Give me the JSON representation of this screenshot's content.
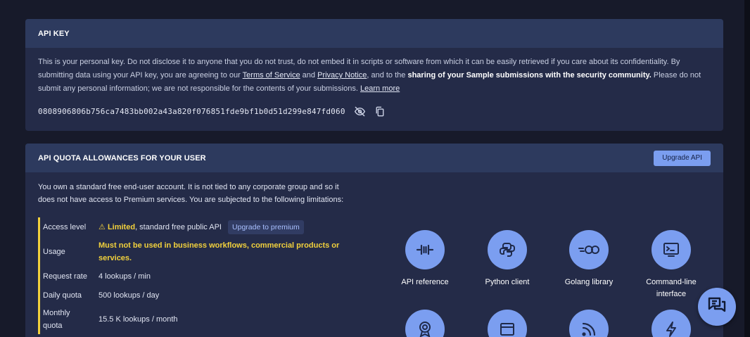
{
  "api_key": {
    "title": "API KEY",
    "para_1": "This is your personal key. Do not disclose it to anyone that you do not trust, do not embed it in scripts or software from which it can be easily retrieved if you care about its confidentiality. By submitting data using your API key, you are agreeing to our ",
    "terms_link": "Terms of Service",
    "and_text": " and ",
    "privacy_link": "Privacy Notice",
    "para_2": ", and to the ",
    "sharing_bold": "sharing of your Sample submissions with the security community.",
    "para_3": " Please do not submit any personal information; we are not responsible for the contents of your submissions. ",
    "learn_more": "Learn more",
    "key_value": "0808906806b756ca7483bb002a43a820f076851fde9bf1b0d51d299e847fd060",
    "icons": {
      "hide": "eye-slash-icon",
      "copy": "copy-icon"
    }
  },
  "quota": {
    "title": "API QUOTA ALLOWANCES FOR YOUR USER",
    "upgrade_button": "Upgrade API",
    "intro": "You own a standard free end-user account. It is not tied to any corporate group and so it does not have access to Premium services. You are subjected to the following limitations:",
    "rows": [
      {
        "key": "Access level",
        "warn_icon": "⚠",
        "value_bold": "Limited",
        "value_rest": ", standard free public API",
        "pill": "Upgrade to premium"
      },
      {
        "key": "Usage",
        "value": "Must not be used in business workflows, commercial products or services."
      },
      {
        "key": "Request rate",
        "value": "4 lookups / min"
      },
      {
        "key": "Daily quota",
        "value": "500 lookups / day"
      },
      {
        "key": "Monthly quota",
        "value": "15.5 K lookups / month"
      }
    ]
  },
  "resources": [
    {
      "label": "API reference",
      "icon": "api-icon"
    },
    {
      "label": "Python client",
      "icon": "python-icon"
    },
    {
      "label": "Golang library",
      "icon": "gopher-icon"
    },
    {
      "label": "Command-line interface",
      "icon": "terminal-icon"
    },
    {
      "label": "",
      "icon": "badge-icon"
    },
    {
      "label": "",
      "icon": "window-icon"
    },
    {
      "label": "",
      "icon": "rss-icon"
    },
    {
      "label": "",
      "icon": "bolt-icon"
    }
  ],
  "colors": {
    "accent": "#7b9ef0",
    "warning": "#f2d13c",
    "card": "#242b48",
    "card_header": "#2d3a5e",
    "background": "#171a2a"
  },
  "chat": {
    "icon": "chat-icon"
  }
}
